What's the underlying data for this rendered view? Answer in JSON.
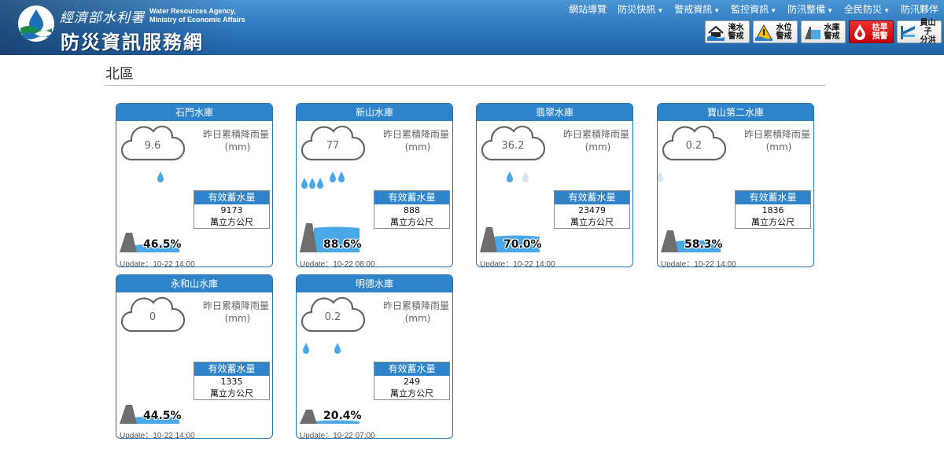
{
  "header": {
    "ministry": "經濟部水利署",
    "agency_en_line1": "Water Resources Agency,",
    "agency_en_line2": "Ministry of Economic Affairs",
    "site_title": "防災資訊服務網",
    "nav": [
      "網站導覽",
      "防災快訊",
      "警戒資訊",
      "監控資訊",
      "防汛整備",
      "全民防災",
      "防汛夥伴"
    ],
    "nav_has_caret": [
      false,
      true,
      true,
      true,
      true,
      true,
      false
    ],
    "alerts": [
      {
        "label1": "淹水",
        "label2": "警戒",
        "icon": "flood-icon"
      },
      {
        "label1": "水位",
        "label2": "警戒",
        "icon": "water-level-icon"
      },
      {
        "label1": "水庫",
        "label2": "警戒",
        "icon": "reservoir-icon"
      },
      {
        "label1": "枯旱",
        "label2": "預警",
        "icon": "drought-drop-icon",
        "style": "red"
      },
      {
        "label1": "員山子",
        "label2": "分洪",
        "icon": "diversion-icon"
      }
    ]
  },
  "section": {
    "title": "北區"
  },
  "card_labels": {
    "rain_label": "昨日累積降雨量",
    "rain_unit": "(mm)",
    "storage_label": "有效蓄水量",
    "storage_unit": "萬立方公尺"
  },
  "colors": {
    "header_blue": "#2c76bd",
    "card_blue": "#2f84c9",
    "water": "#4aa8e8",
    "alert_red": "#d81818"
  },
  "reservoirs": [
    {
      "name": "石門水庫",
      "rain": "9.6",
      "storage": "9173",
      "percent": "46.5%",
      "percent_value": 46.5,
      "drops": 1,
      "update": "Update：10-22 14:00"
    },
    {
      "name": "新山水庫",
      "rain": "77",
      "storage": "888",
      "percent": "88.6%",
      "percent_value": 88.6,
      "drops": 5,
      "update": "Update：10-22 08:00"
    },
    {
      "name": "翡翠水庫",
      "rain": "36.2",
      "storage": "23479",
      "percent": "70.0%",
      "percent_value": 70.0,
      "drops": 2,
      "update": "Update：10-22 14:00"
    },
    {
      "name": "寶山第二水庫",
      "rain": "0.2",
      "storage": "1836",
      "percent": "58.3%",
      "percent_value": 58.3,
      "drops": 1,
      "update": "Update：10-22 14:00"
    },
    {
      "name": "永和山水庫",
      "rain": "0",
      "storage": "1335",
      "percent": "44.5%",
      "percent_value": 44.5,
      "drops": 0,
      "update": "Update：10-22 14:00"
    },
    {
      "name": "明德水庫",
      "rain": "0.2",
      "storage": "249",
      "percent": "20.4%",
      "percent_value": 20.4,
      "drops": 2,
      "update": "Update：10-22 07:00"
    }
  ]
}
